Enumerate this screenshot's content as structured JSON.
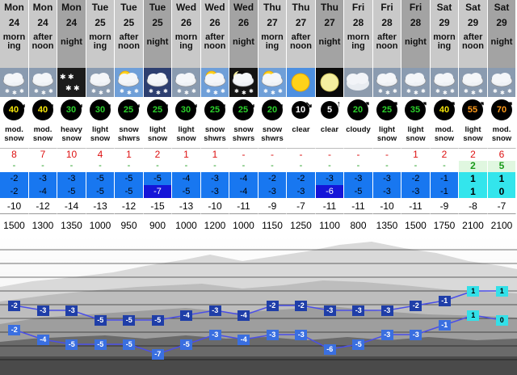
{
  "colors": {
    "cold_dark": "#1515d8",
    "cold": "#1877f0",
    "cold_light": "#35a8ff",
    "warm": "#33e5ec",
    "line": "#4a4ee8"
  },
  "columns": [
    {
      "day": "Mon",
      "date": "24",
      "time": "morn-ing",
      "tod": "day",
      "icon": "cloud-snow-icon",
      "wind": "40",
      "wdir": "↘",
      "ring": "yellow",
      "summary": "mod. snow",
      "snow": "8",
      "rain": "-",
      "max": "-2",
      "min": "-2",
      "chill": "-10",
      "fl": "1500"
    },
    {
      "day": "Mon",
      "date": "24",
      "time": "after-noon",
      "tod": "day",
      "icon": "cloud-snow-icon",
      "wind": "40",
      "wdir": "↘",
      "ring": "yellow",
      "summary": "mod. snow",
      "snow": "7",
      "rain": "-",
      "max": "-3",
      "min": "-4",
      "chill": "-12",
      "fl": "1300"
    },
    {
      "day": "Mon",
      "date": "24",
      "time": "night",
      "tod": "night",
      "icon": "night-heavy-snow-icon",
      "wind": "30",
      "wdir": "↘",
      "ring": "green",
      "summary": "heavy snow",
      "snow": "10",
      "rain": "-",
      "max": "-3",
      "min": "-5",
      "chill": "-14",
      "fl": "1350"
    },
    {
      "day": "Tue",
      "date": "25",
      "time": "morn-ing",
      "tod": "day",
      "icon": "cloud-snow-icon",
      "wind": "30",
      "wdir": "↘",
      "ring": "green",
      "summary": "light snow",
      "snow": "4",
      "rain": "-",
      "max": "-5",
      "min": "-5",
      "chill": "-13",
      "fl": "1000"
    },
    {
      "day": "Tue",
      "date": "25",
      "time": "after-noon",
      "tod": "day",
      "icon": "sun-cloud-snow-icon",
      "wind": "25",
      "wdir": "↘",
      "ring": "green",
      "summary": "snow shwrs",
      "snow": "1",
      "rain": "-",
      "max": "-5",
      "min": "-5",
      "chill": "-12",
      "fl": "950"
    },
    {
      "day": "Tue",
      "date": "25",
      "time": "night",
      "tod": "night",
      "icon": "night-cloud-snow-icon",
      "wind": "25",
      "wdir": "↘",
      "ring": "green",
      "summary": "light snow",
      "snow": "2",
      "rain": "-",
      "max": "-5",
      "min": "-7",
      "chill": "-15",
      "fl": "900"
    },
    {
      "day": "Wed",
      "date": "26",
      "time": "morn-ing",
      "tod": "day",
      "icon": "cloud-snow-icon",
      "wind": "30",
      "wdir": "↘",
      "ring": "green",
      "summary": "light snow",
      "snow": "1",
      "rain": "-",
      "max": "-4",
      "min": "-5",
      "chill": "-13",
      "fl": "1000"
    },
    {
      "day": "Wed",
      "date": "26",
      "time": "after-noon",
      "tod": "day",
      "icon": "sun-cloud-snow-icon",
      "wind": "25",
      "wdir": "↘",
      "ring": "green",
      "summary": "snow shwrs",
      "snow": "1",
      "rain": "-",
      "max": "-3",
      "min": "-3",
      "chill": "-10",
      "fl": "1200"
    },
    {
      "day": "Wed",
      "date": "26",
      "time": "night",
      "tod": "night",
      "icon": "moon-cloud-snow-icon",
      "wind": "25",
      "wdir": "↘",
      "ring": "green",
      "summary": "snow shwrs",
      "snow": "-",
      "rain": "-",
      "max": "-4",
      "min": "-4",
      "chill": "-11",
      "fl": "1000"
    },
    {
      "day": "Thu",
      "date": "27",
      "time": "morn-ing",
      "tod": "day",
      "icon": "sun-cloud-snow-icon",
      "wind": "20",
      "wdir": "↘",
      "ring": "green",
      "summary": "snow shwrs",
      "snow": "-",
      "rain": "-",
      "max": "-2",
      "min": "-3",
      "chill": "-9",
      "fl": "1150"
    },
    {
      "day": "Thu",
      "date": "27",
      "time": "after-noon",
      "tod": "day",
      "icon": "sun-icon",
      "wind": "10",
      "wdir": "↘",
      "ring": "white",
      "summary": "clear",
      "snow": "-",
      "rain": "-",
      "max": "-2",
      "min": "-3",
      "chill": "-7",
      "fl": "1250"
    },
    {
      "day": "Thu",
      "date": "27",
      "time": "night",
      "tod": "night",
      "icon": "moon-icon",
      "wind": "5",
      "wdir": "↑",
      "ring": "white",
      "summary": "clear",
      "snow": "-",
      "rain": "-",
      "max": "-3",
      "min": "-6",
      "chill": "-11",
      "fl": "1100"
    },
    {
      "day": "Fri",
      "date": "28",
      "time": "morn-ing",
      "tod": "day",
      "icon": "cloud-icon",
      "wind": "20",
      "wdir": "↗",
      "ring": "green",
      "summary": "cloudy",
      "snow": "-",
      "rain": "-",
      "max": "-3",
      "min": "-5",
      "chill": "-11",
      "fl": "800"
    },
    {
      "day": "Fri",
      "date": "28",
      "time": "after-noon",
      "tod": "day",
      "icon": "cloud-snow-icon",
      "wind": "25",
      "wdir": "↗",
      "ring": "green",
      "summary": "light snow",
      "snow": "-",
      "rain": "-",
      "max": "-3",
      "min": "-3",
      "chill": "-10",
      "fl": "1350"
    },
    {
      "day": "Fri",
      "date": "28",
      "time": "night",
      "tod": "night",
      "icon": "cloud-snow-icon",
      "wind": "35",
      "wdir": "↗",
      "ring": "green",
      "summary": "light snow",
      "snow": "1",
      "rain": "-",
      "max": "-2",
      "min": "-3",
      "chill": "-11",
      "fl": "1500"
    },
    {
      "day": "Sat",
      "date": "29",
      "time": "morn-ing",
      "tod": "day",
      "icon": "cloud-snow-icon",
      "wind": "40",
      "wdir": "↗",
      "ring": "yellow",
      "summary": "mod. snow",
      "snow": "2",
      "rain": "-",
      "max": "-1",
      "min": "-1",
      "chill": "-9",
      "fl": "1750"
    },
    {
      "day": "Sat",
      "date": "29",
      "time": "after-noon",
      "tod": "day",
      "icon": "cloud-snow-icon",
      "wind": "55",
      "wdir": "↗",
      "ring": "orange",
      "summary": "light snow",
      "snow": "2",
      "rain": "2",
      "max": "1",
      "min": "1",
      "chill": "-8",
      "fl": "2100"
    },
    {
      "day": "Sat",
      "date": "29",
      "time": "night",
      "tod": "night",
      "icon": "cloud-snow-icon",
      "wind": "70",
      "wdir": "↗",
      "ring": "orange",
      "summary": "mod. snow",
      "snow": "6",
      "rain": "5",
      "max": "1",
      "min": "0",
      "chill": "-7",
      "fl": "2100"
    }
  ]
}
